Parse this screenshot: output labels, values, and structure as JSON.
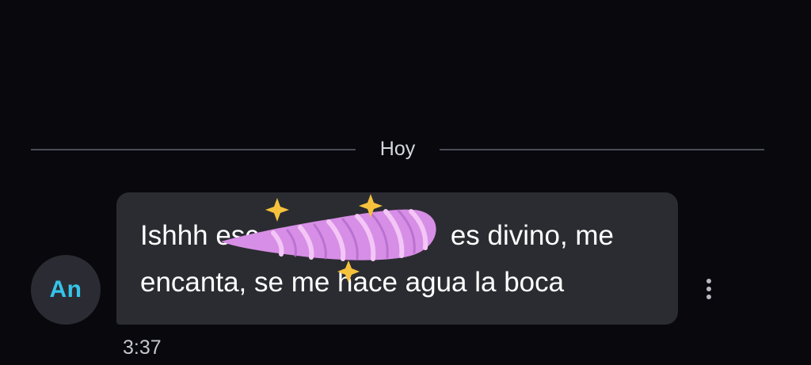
{
  "divider": {
    "label": "Hoy"
  },
  "message": {
    "avatar_initials": "An",
    "text_line_1": "Ishhh esc",
    "text_line_1_end": "es divino, me",
    "text_line_2": "encanta, se me hace agua la boca",
    "time": "3:37",
    "sticker_icon": "unicorn-horn-sticker",
    "more_icon": "more-vertical-icon"
  },
  "colors": {
    "background": "#08080d",
    "bubble": "#2b2c31",
    "avatar_bg": "#2b2c33",
    "avatar_text": "#35c4ea",
    "divider": "#4a4d57",
    "sticker_pink": "#d78ee6",
    "sparkle": "#f6c23d"
  }
}
